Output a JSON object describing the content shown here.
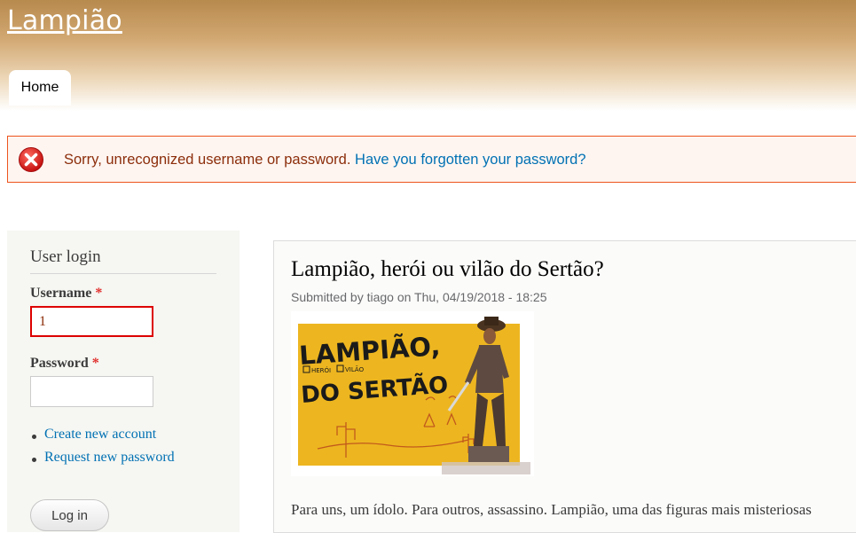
{
  "site": {
    "name": "Lampião"
  },
  "nav": {
    "tabs": [
      {
        "label": "Home"
      }
    ]
  },
  "messages": {
    "error_text": "Sorry, unrecognized username or password.",
    "error_link": "Have you forgotten your password?"
  },
  "login": {
    "title": "User login",
    "username_label": "Username",
    "username_value": "1",
    "password_label": "Password",
    "required_marker": "*",
    "links": [
      {
        "label": "Create new account"
      },
      {
        "label": "Request new password"
      }
    ],
    "submit_label": "Log in"
  },
  "article": {
    "title": "Lampião, herói ou vilão do Sertão?",
    "submitted": "Submitted by tiago on Thu, 04/19/2018 - 18:25",
    "image": {
      "line1": "LAMPIÃO,",
      "opt1": "HERÓI",
      "opt2": "VILÃO",
      "line2": "DO SERTÃO"
    },
    "body_start": "Para uns, um ídolo. Para outros, assassino. Lampião, uma das figuras mais misteriosas"
  },
  "colors": {
    "link": "#0071b3",
    "error_border": "#ed541d",
    "error_text": "#8c2e0b",
    "header_top": "#b78a4e"
  }
}
